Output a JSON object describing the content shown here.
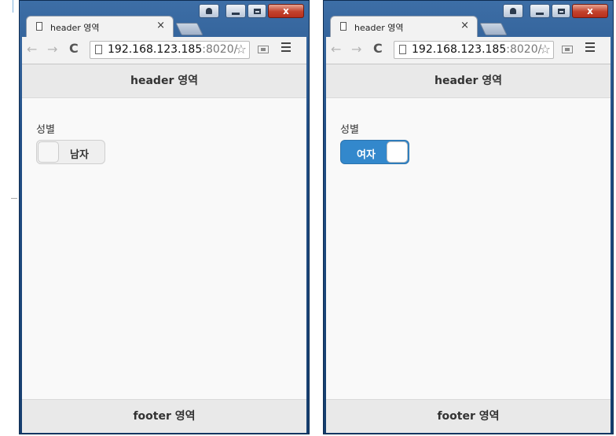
{
  "windows": [
    {
      "tab_title": "header 영역",
      "url_host": "192.168.123.185",
      "url_port": ":8020/",
      "header_text": "header 영역",
      "field_label": "성별",
      "switch_state": "off",
      "switch_text": "남자",
      "footer_text": "footer 영역"
    },
    {
      "tab_title": "header 영역",
      "url_host": "192.168.123.185",
      "url_port": ":8020/",
      "header_text": "header 영역",
      "field_label": "성별",
      "switch_state": "on",
      "switch_text": "여자",
      "footer_text": "footer 영역"
    }
  ],
  "icons": {
    "back": "←",
    "forward": "→",
    "reload": "C",
    "star": "☆",
    "tab_close": "×",
    "window_close": "x"
  },
  "colors": {
    "switch_on": "#3388cc",
    "window_frame": "#224f86",
    "close_button": "#c2412c"
  }
}
